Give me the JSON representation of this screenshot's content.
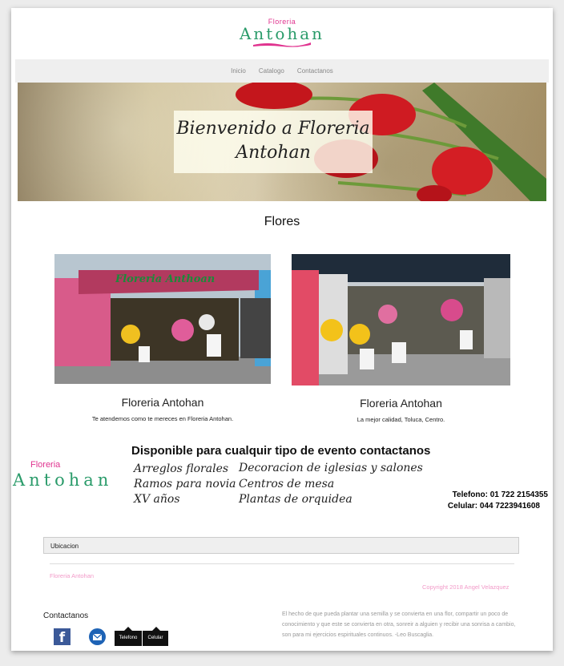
{
  "brand": {
    "small": "Floreria",
    "big": "Antohan"
  },
  "nav": [
    "Inicio",
    "Catalogo",
    "Contactanos"
  ],
  "hero": {
    "line1": "Bienvenido a Floreria",
    "line2": "Antohan"
  },
  "section": {
    "title": "Flores"
  },
  "cards": [
    {
      "sign": "Floreria Anthoan",
      "title": "Floreria Antohan",
      "subtitle": "Te atendemos como te mereces en Floreria Antohan."
    },
    {
      "title": "Floreria Antohan",
      "subtitle": "La mejor calidad, Toluca, Centro."
    }
  ],
  "promo": {
    "title": "Disponible para cualquir tipo de evento contactanos",
    "col1": [
      "Arreglos florales",
      "Ramos para novia",
      "XV años"
    ],
    "col2": [
      "Decoracion de iglesias y salones",
      "Centros de mesa",
      "Plantas de orquidea"
    ],
    "logo_small": "Floreria",
    "logo_big": "Antohan",
    "phone": "Telefono: 01 722 2154355",
    "cell": "Celular: 044 7223941608"
  },
  "location": {
    "label": "Ubicacion"
  },
  "footer": {
    "brand": "Floreria Antohan",
    "copyright": "Copyright 2018 Angel Velazquez",
    "contact_title": "Contactanos",
    "quote": "El hecho de que pueda plantar una semilla y se convierta en una flor, compartir un poco de conocimiento y que este se convierta en otra, sonreir a alguien y recibir una sonrisa a cambio, son para mi ejercicios espirituales continuos. -Leo Buscaglia.",
    "tooltips": [
      "Telefono",
      "Celular"
    ],
    "facebook_glyph": "f"
  },
  "colors": {
    "brand_pink": "#e0338f",
    "brand_green": "#2a9b6a",
    "link_pink": "#f29ac8",
    "facebook": "#3b5998",
    "mail": "#1e63b5"
  }
}
